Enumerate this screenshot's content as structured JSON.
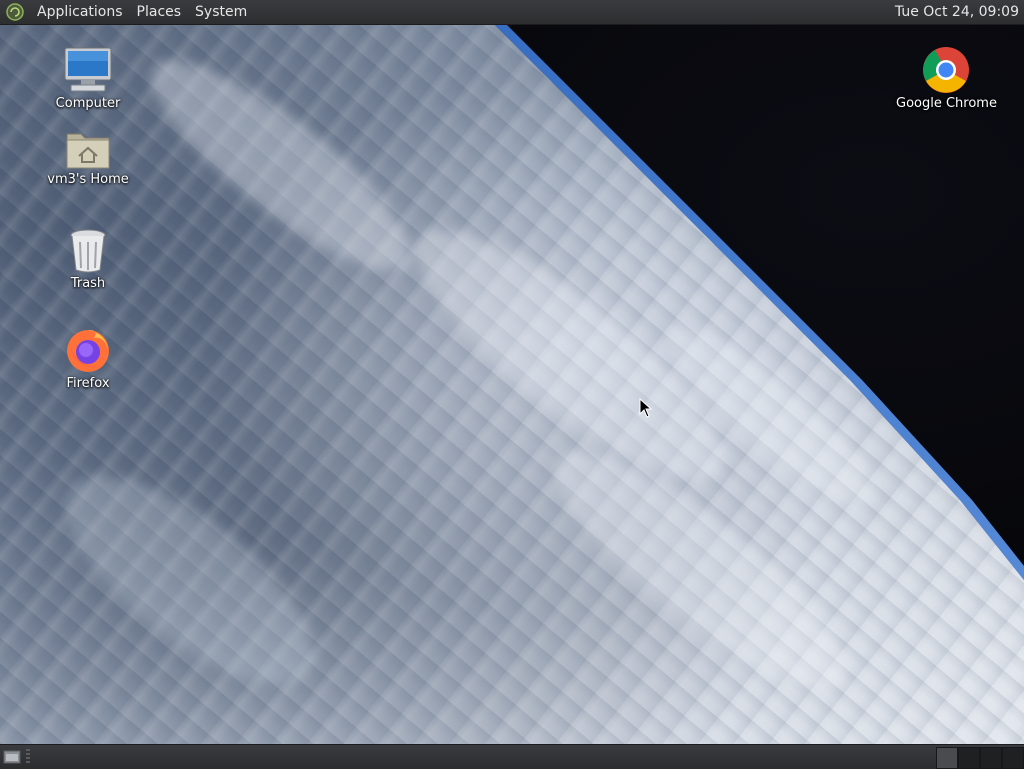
{
  "top_panel": {
    "menus": [
      "Applications",
      "Places",
      "System"
    ],
    "clock": "Tue Oct 24, 09:09"
  },
  "desktop": {
    "icons": [
      {
        "label": "Computer",
        "icon": "computer-icon"
      },
      {
        "label": "vm3's Home",
        "icon": "home-folder-icon"
      },
      {
        "label": "Trash",
        "icon": "trash-icon"
      },
      {
        "label": "Firefox",
        "icon": "firefox-icon"
      },
      {
        "label": "Google Chrome",
        "icon": "chrome-icon"
      }
    ]
  },
  "bottom_panel": {
    "workspaces": 4,
    "active_workspace": 1
  },
  "colors": {
    "panel": "#2d2e30",
    "panel_text": "#e6e6e6",
    "atmosphere": "#2d6fd6"
  }
}
